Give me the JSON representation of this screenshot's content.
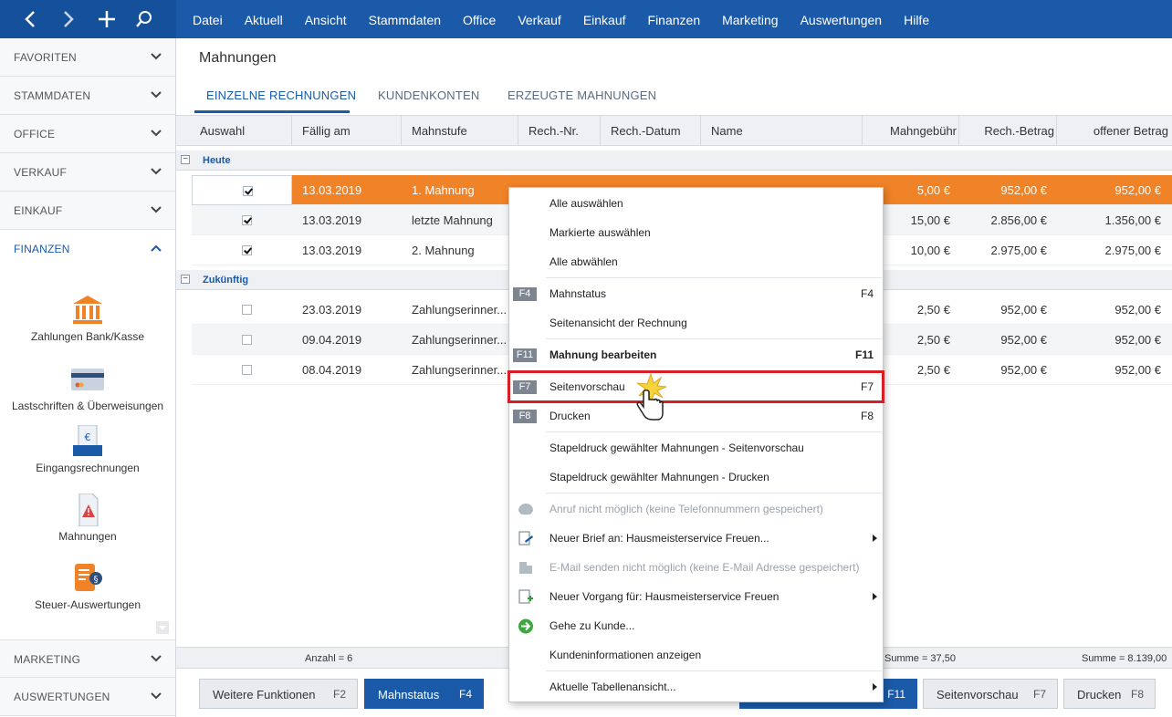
{
  "top_menu": [
    "Datei",
    "Aktuell",
    "Ansicht",
    "Stammdaten",
    "Office",
    "Verkauf",
    "Einkauf",
    "Finanzen",
    "Marketing",
    "Auswertungen",
    "Hilfe"
  ],
  "sidebar": {
    "sections": [
      "FAVORITEN",
      "STAMMDATEN",
      "OFFICE",
      "VERKAUF",
      "EINKAUF",
      "FINANZEN",
      "MARKETING",
      "AUSWERTUNGEN"
    ],
    "finance_items": [
      "Zahlungen Bank/Kasse",
      "Lastschriften & Überweisungen",
      "Eingangsrechnungen",
      "Mahnungen",
      "Steuer-Auswertungen"
    ]
  },
  "page": {
    "title": "Mahnungen",
    "tabs": [
      "EINZELNE RECHNUNGEN",
      "KUNDENKONTEN",
      "ERZEUGTE MAHNUNGEN"
    ]
  },
  "grid": {
    "columns": [
      "Auswahl",
      "Fällig am",
      "Mahnstufe",
      "Rech.-Nr.",
      "Rech.-Datum",
      "Name",
      "Mahngebühr",
      "Rech.-Betrag",
      "offener Betrag"
    ],
    "groups": [
      {
        "label": "Heute",
        "rows": [
          {
            "checked": true,
            "due": "13.03.2019",
            "level": "1. Mahnung",
            "fee": "5,00 €",
            "amount": "952,00 €",
            "open": "952,00 €"
          },
          {
            "checked": true,
            "due": "13.03.2019",
            "level": "letzte Mahnung",
            "fee": "15,00 €",
            "amount": "2.856,00 €",
            "open": "1.356,00 €"
          },
          {
            "checked": true,
            "due": "13.03.2019",
            "level": "2. Mahnung",
            "fee": "10,00 €",
            "amount": "2.975,00 €",
            "open": "2.975,00 €"
          }
        ]
      },
      {
        "label": "Zukünftig",
        "rows": [
          {
            "checked": false,
            "due": "23.03.2019",
            "level": "Zahlungserinner...",
            "fee": "2,50 €",
            "amount": "952,00 €",
            "open": "952,00 €"
          },
          {
            "checked": false,
            "due": "09.04.2019",
            "level": "Zahlungserinner...",
            "fee": "2,50 €",
            "amount": "952,00 €",
            "open": "952,00 €"
          },
          {
            "checked": false,
            "due": "08.04.2019",
            "level": "Zahlungserinner...",
            "fee": "2,50 €",
            "amount": "952,00 €",
            "open": "952,00 €"
          }
        ]
      }
    ],
    "footer": {
      "count": "Anzahl = 6",
      "fee_sum": "Summe = 37,50",
      "open_sum": "Summe = 8.139,00"
    }
  },
  "buttons": {
    "more": {
      "label": "Weitere Funktionen",
      "key": "F2"
    },
    "status": {
      "label": "Mahnstatus",
      "key": "F4"
    },
    "edit_key": "F11",
    "preview": {
      "label": "Seitenvorschau",
      "key": "F7"
    },
    "print": {
      "label": "Drucken",
      "key": "F8"
    }
  },
  "context_menu": {
    "items": [
      {
        "label": "Alle auswählen"
      },
      {
        "label": "Markierte auswählen"
      },
      {
        "label": "Alle abwählen"
      },
      {
        "label": "Mahnstatus",
        "key": "F4",
        "badge": "F4"
      },
      {
        "label": "Seitenansicht der Rechnung"
      },
      {
        "label": "Mahnung bearbeiten",
        "key": "F11",
        "badge": "F11"
      },
      {
        "label": "Seitenvorschau",
        "key": "F7",
        "badge": "F7"
      },
      {
        "label": "Drucken",
        "key": "F8",
        "badge": "F8"
      },
      {
        "label": "Stapeldruck gewählter Mahnungen - Seitenvorschau"
      },
      {
        "label": "Stapeldruck gewählter Mahnungen - Drucken"
      },
      {
        "label": "Anruf nicht möglich (keine Telefonnummern gespeichert)"
      },
      {
        "label": "Neuer Brief an: Hausmeisterservice Freuen..."
      },
      {
        "label": "E-Mail senden nicht möglich (keine E-Mail Adresse gespeichert)"
      },
      {
        "label": "Neuer Vorgang für: Hausmeisterservice Freuen"
      },
      {
        "label": "Gehe zu Kunde..."
      },
      {
        "label": "Kundeninformationen anzeigen"
      },
      {
        "label": "Aktuelle Tabellenansicht..."
      }
    ]
  },
  "colors": {
    "primary": "#1a5aa8",
    "selected_row": "#f08228",
    "highlight": "#d61f26"
  }
}
